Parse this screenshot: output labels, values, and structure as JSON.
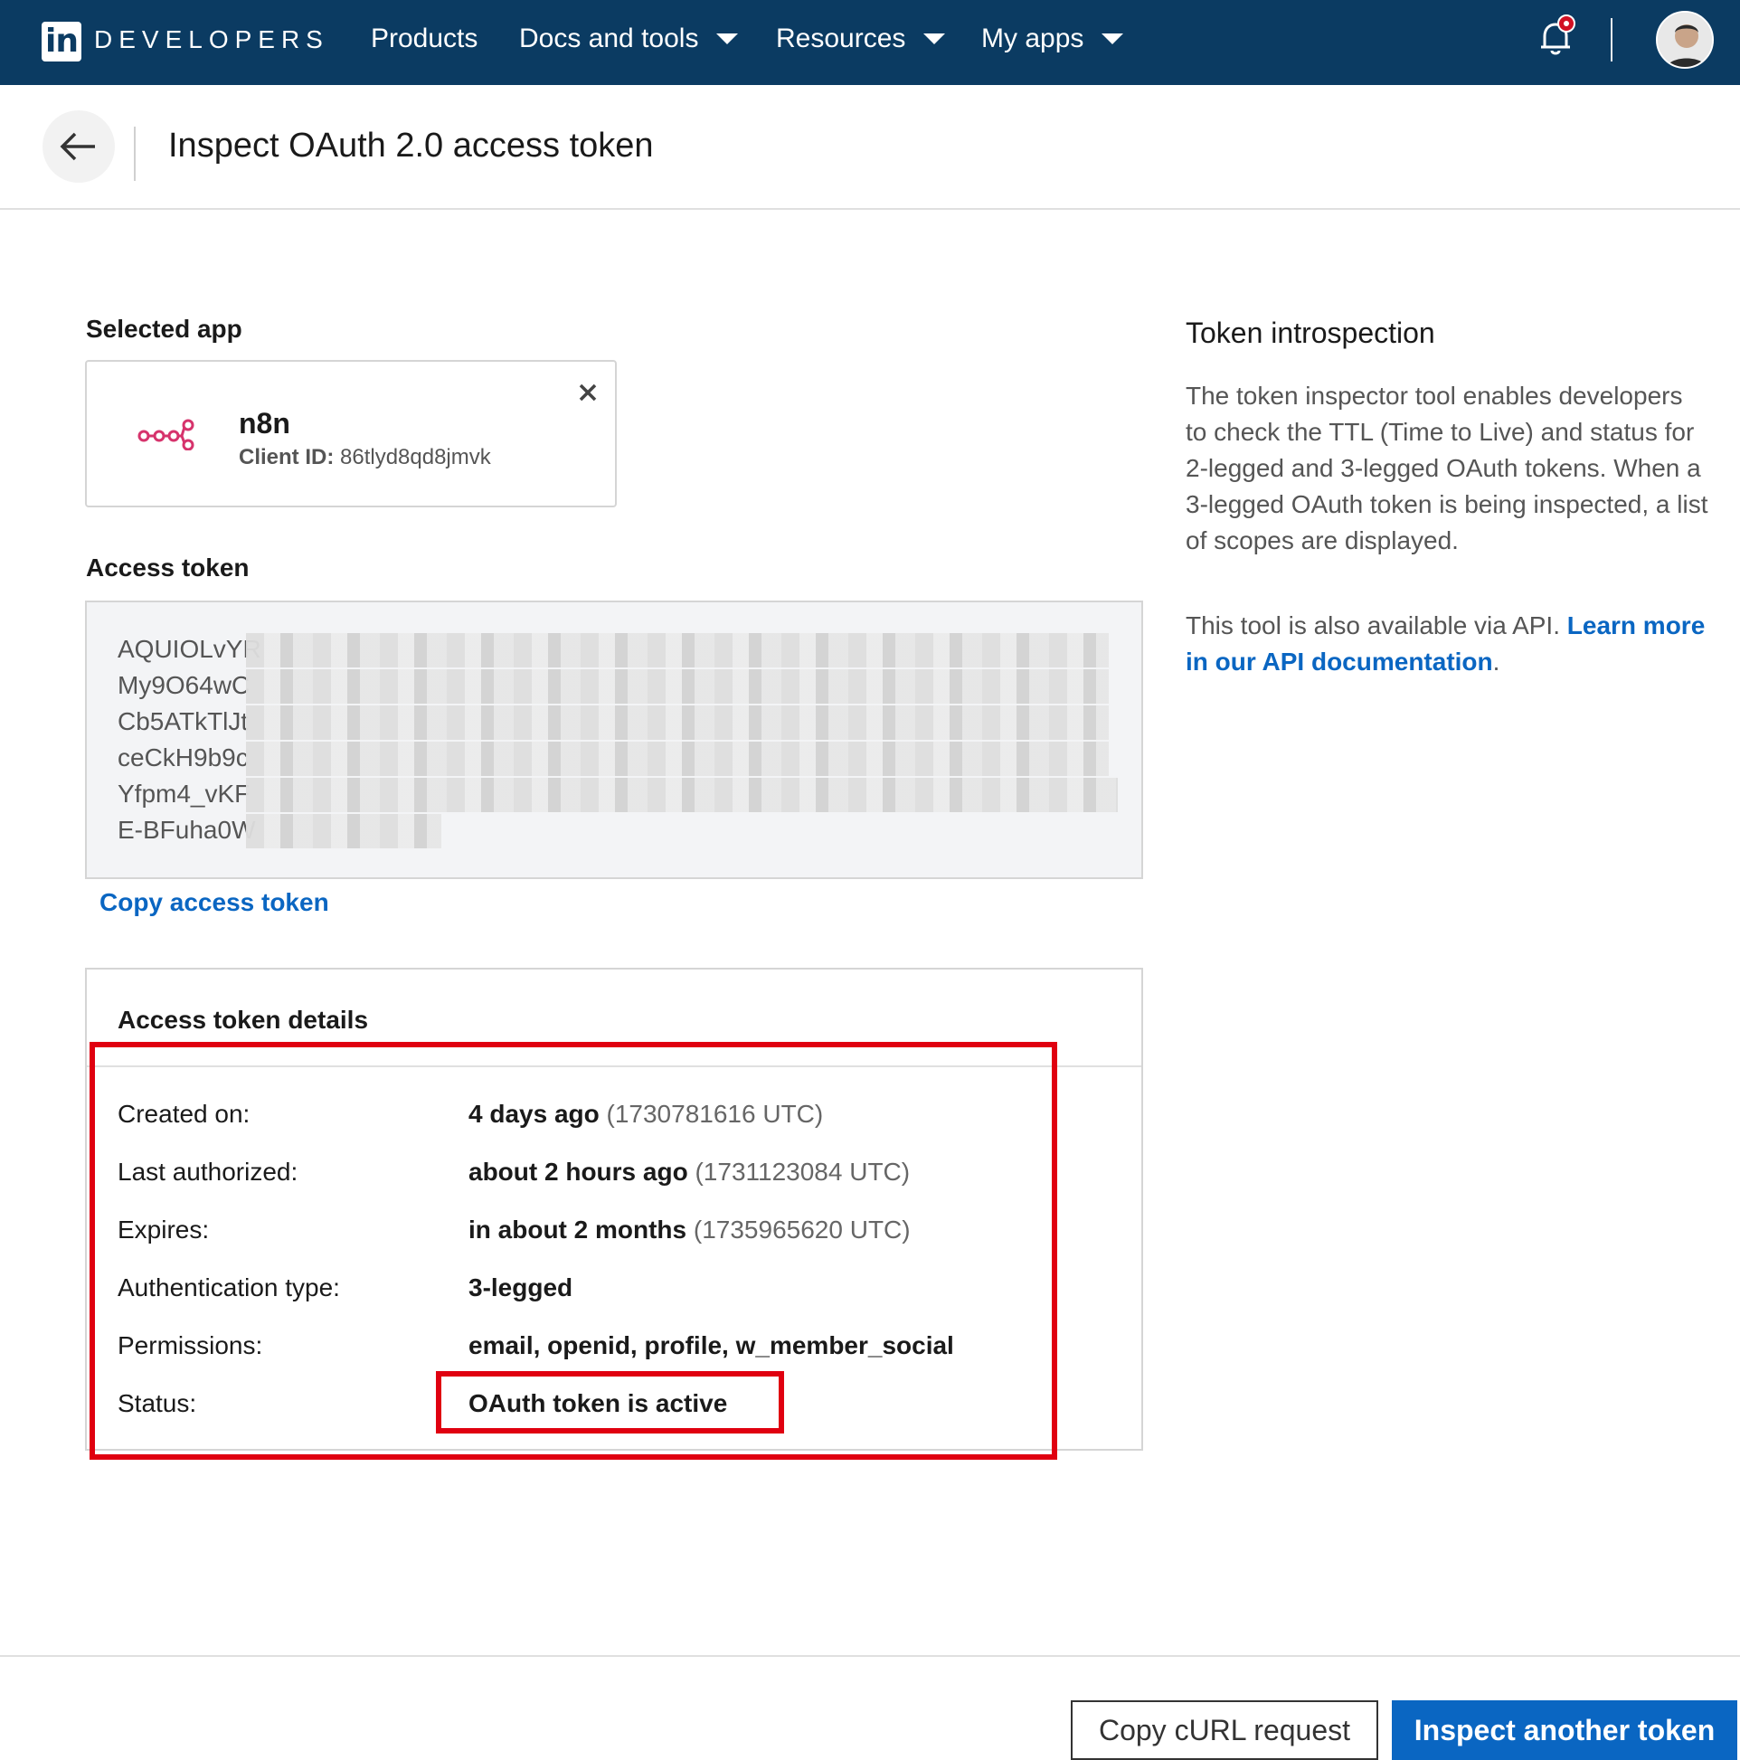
{
  "nav": {
    "logo_text": "in",
    "brand": "DEVELOPERS",
    "items": [
      {
        "label": "Products"
      },
      {
        "label": "Docs and tools"
      },
      {
        "label": "Resources"
      },
      {
        "label": "My apps"
      }
    ],
    "notification_icon": "bell-icon",
    "has_notification": true
  },
  "header": {
    "title": "Inspect OAuth 2.0 access token",
    "back_icon": "arrow-left-icon"
  },
  "selected_app": {
    "label": "Selected app",
    "name": "n8n",
    "client_id_label": "Client ID:",
    "client_id": "86tlyd8qd8jmvk",
    "icon": "n8n-logo-icon"
  },
  "access_token": {
    "label": "Access token",
    "visible_lines": [
      "AQUIOLvYR",
      "My9O64wC",
      "Cb5ATkTlJt",
      "ceCkH9b9c",
      "Yfpm4_vKF",
      "E-BFuha0W"
    ],
    "copy_label": "Copy access token"
  },
  "details": {
    "title": "Access token details",
    "rows": [
      {
        "label": "Created on:",
        "value": "4 days ago",
        "extra": "(1730781616 UTC)"
      },
      {
        "label": "Last authorized:",
        "value": "about 2 hours ago",
        "extra": "(1731123084 UTC)"
      },
      {
        "label": "Expires:",
        "value": "in about 2 months",
        "extra": "(1735965620 UTC)"
      },
      {
        "label": "Authentication type:",
        "value": "3-legged",
        "extra": ""
      },
      {
        "label": "Permissions:",
        "value": "email, openid, profile, w_member_social",
        "extra": ""
      },
      {
        "label": "Status:",
        "value": "OAuth token is active",
        "extra": ""
      }
    ]
  },
  "introspection": {
    "title": "Token introspection",
    "description": "The token inspector tool enables developers to check the TTL (Time to Live) and status for 2-legged and 3-legged OAuth tokens. When a 3-legged OAuth token is being inspected, a list of scopes are displayed.",
    "api_prefix": "This tool is also available via API.",
    "api_link": "Learn more in our API documentation",
    "api_suffix": "."
  },
  "footer": {
    "copy_curl": "Copy cURL request",
    "inspect_another": "Inspect another token"
  },
  "colors": {
    "nav_bg": "#0b3b62",
    "link": "#0a66c2",
    "annotation_red": "#e00010",
    "app_icon": "#d6336c"
  }
}
